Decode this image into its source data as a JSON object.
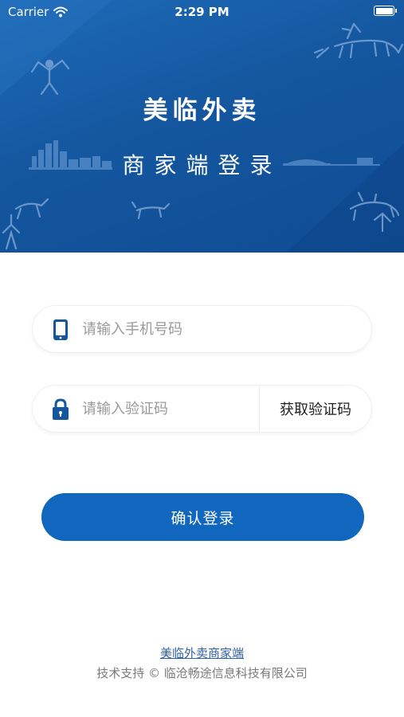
{
  "status_bar": {
    "carrier": "Carrier",
    "time": "2:29 PM"
  },
  "header": {
    "title": "美临外卖",
    "subtitle": "商家端登录",
    "background_color": "#14579f"
  },
  "form": {
    "phone": {
      "placeholder": "请输入手机号码",
      "value": "",
      "icon": "smartphone-icon"
    },
    "code": {
      "placeholder": "请输入验证码",
      "value": "",
      "icon": "lock-icon",
      "get_code_label": "获取验证码"
    },
    "submit_label": "确认登录",
    "accent_color": "#1166bd"
  },
  "footer": {
    "link_text": "美临外卖商家端",
    "copyright": "技术支持 © 临沧畅途信息科技有限公司"
  }
}
